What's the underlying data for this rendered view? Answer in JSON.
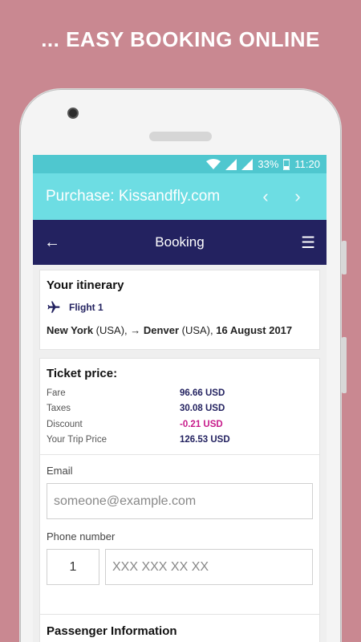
{
  "headline": "... EASY BOOKING ONLINE",
  "status": {
    "battery": "33%",
    "time": "11:20"
  },
  "appbar": {
    "title": "Purchase: Kissandfly.com",
    "prev": "‹",
    "next": "›"
  },
  "topbar": {
    "back": "←",
    "title": "Booking",
    "menu": "☰"
  },
  "itinerary": {
    "heading": "Your itinerary",
    "flight_label": "Flight 1",
    "from_city": "New York",
    "from_country": "(USA),",
    "arrow": "→",
    "to_city": "Denver",
    "to_country": "(USA),",
    "date": "16 August 2017"
  },
  "price": {
    "heading": "Ticket price:",
    "rows": [
      {
        "label": "Fare",
        "value": "96.66 USD"
      },
      {
        "label": "Taxes",
        "value": "30.08 USD"
      },
      {
        "label": "Discount",
        "value": "-0.21 USD"
      },
      {
        "label": "Your Trip Price",
        "value": "126.53 USD"
      }
    ]
  },
  "form": {
    "email_label": "Email",
    "email_placeholder": "someone@example.com",
    "phone_label": "Phone number",
    "country_code": "1",
    "phone_placeholder": "XXX XXX XX XX"
  },
  "passenger": {
    "heading": "Passenger Information"
  },
  "colors": {
    "accent": "#6ddde3",
    "navy": "#232260",
    "discount": "#c71a8a",
    "background": "#c98891"
  }
}
